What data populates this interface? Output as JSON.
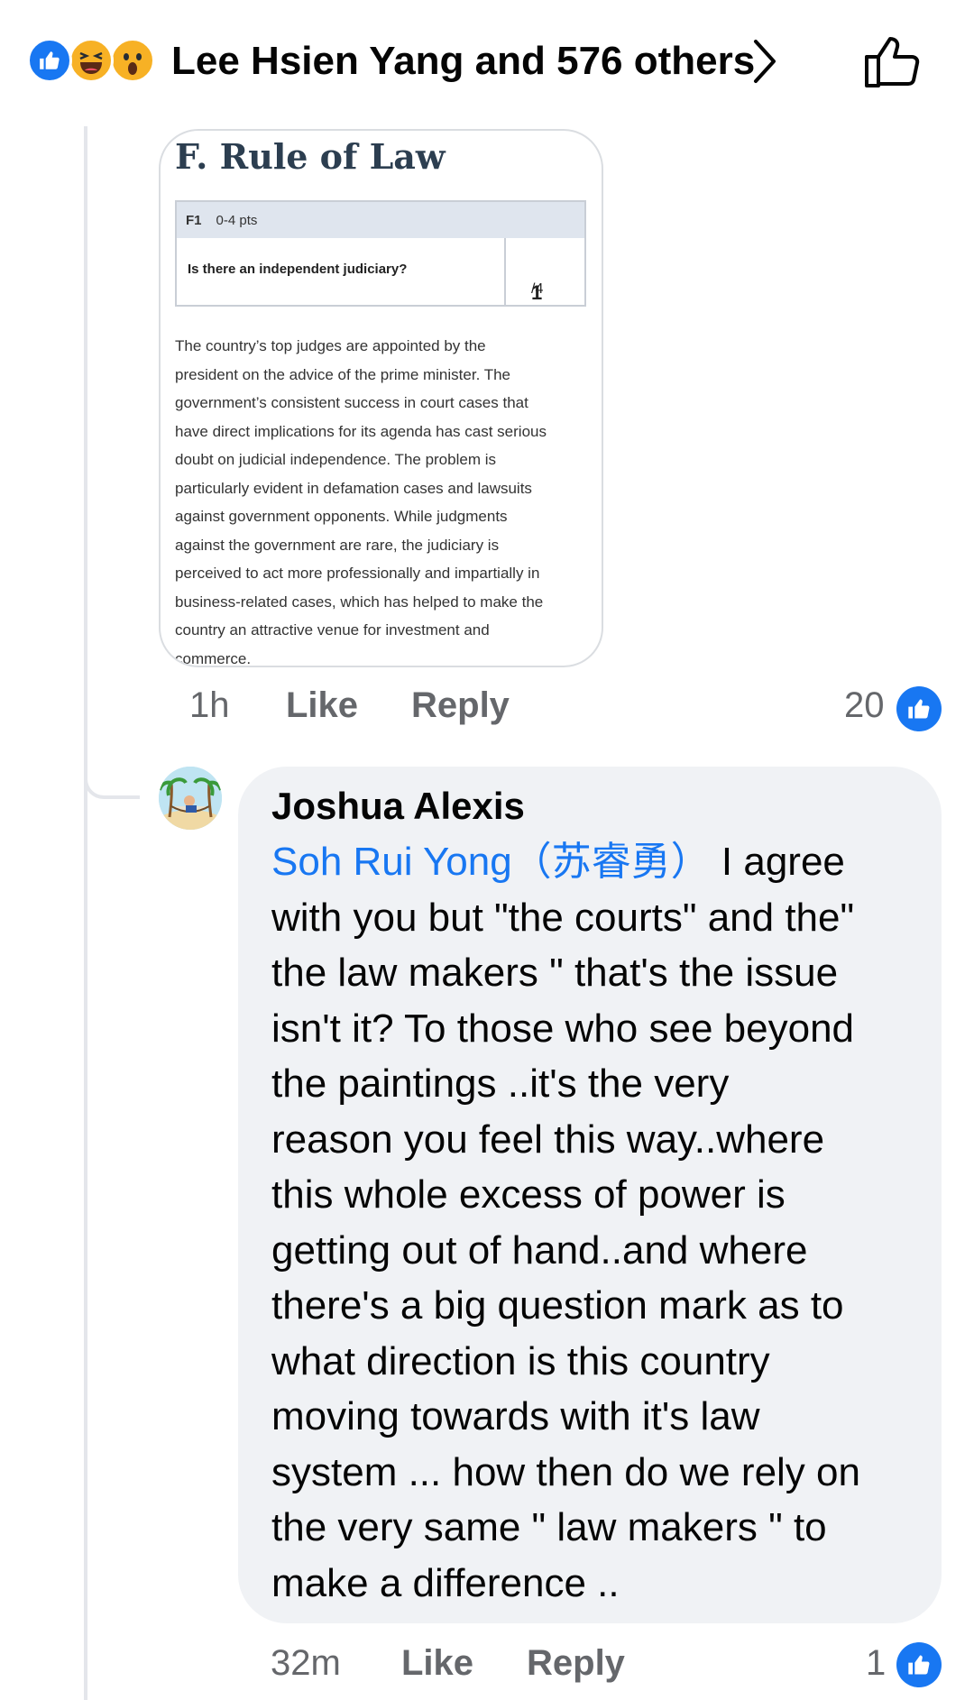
{
  "header": {
    "reaction_icons": [
      "like-icon",
      "haha-icon",
      "wow-icon"
    ],
    "title": "Lee Hsien Yang and 576 others"
  },
  "attachment": {
    "title": "F. Rule of Law",
    "indicator_code": "F1",
    "indicator_points": "0-4 pts",
    "question": "Is there an independent judiciary?",
    "score": "1",
    "score_max": "/4",
    "body_lines": [
      "The country’s top judges are appointed by the",
      "president on the advice of the prime minister. The",
      "government’s consistent success in court cases that",
      "have direct implications for its agenda has cast serious",
      "doubt on judicial independence. The problem is",
      "particularly evident in defamation cases and lawsuits",
      "against government opponents. While judgments",
      "against the government are rare, the judiciary is",
      "perceived to act more professionally and impartially in",
      "business-related cases, which has helped to make the",
      "country an attractive venue for investment and",
      "commerce."
    ]
  },
  "comment1_actions": {
    "time": "1h",
    "like": "Like",
    "reply": "Reply",
    "reaction_count": "20"
  },
  "comment2": {
    "author": "Joshua Alexis",
    "mention": "Soh Rui Yong（苏睿勇）",
    "text": "  I agree\nwith you but \"the courts\" and the\"\nthe law makers \" that's the issue\nisn't it? To those who see beyond\nthe paintings ..it's the very\nreason you feel this way..where\nthis whole excess of power is\ngetting out of hand..and where\nthere's a big question mark as to\nwhat direction is this country\nmoving towards with it's law\nsystem ... how then do we rely on\nthe very same \" law makers \" to\nmake a difference ..",
    "actions": {
      "time": "32m",
      "like": "Like",
      "reply": "Reply",
      "reaction_count": "1"
    }
  },
  "colors": {
    "accent": "#1877f2",
    "bubble": "#f0f2f5",
    "meta": "#65676b"
  }
}
